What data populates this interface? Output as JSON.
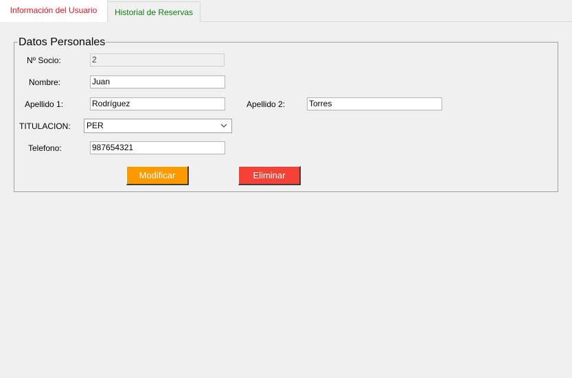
{
  "tabs": [
    {
      "label": "Información del Usuario",
      "active": true,
      "color": "#e81123"
    },
    {
      "label": "Historial de Reservas",
      "active": false,
      "color": "#107c10"
    }
  ],
  "group": {
    "title": "Datos Personales"
  },
  "fields": {
    "socio": {
      "label": "Nº Socio:",
      "value": "2"
    },
    "nombre": {
      "label": "Nombre:",
      "value": "Juan"
    },
    "apellido1": {
      "label": "Apellido 1:",
      "value": "Rodríguez"
    },
    "apellido2": {
      "label": "Apellido 2:",
      "value": "Torres"
    },
    "titulacion": {
      "label": "TITULACION:",
      "value": "PER"
    },
    "telefono": {
      "label": "Telefono:",
      "value": "987654321"
    }
  },
  "buttons": {
    "modificar": {
      "label": "Modificar",
      "color": "#ff9900"
    },
    "eliminar": {
      "label": "Eliminar",
      "color": "#f44336"
    }
  }
}
